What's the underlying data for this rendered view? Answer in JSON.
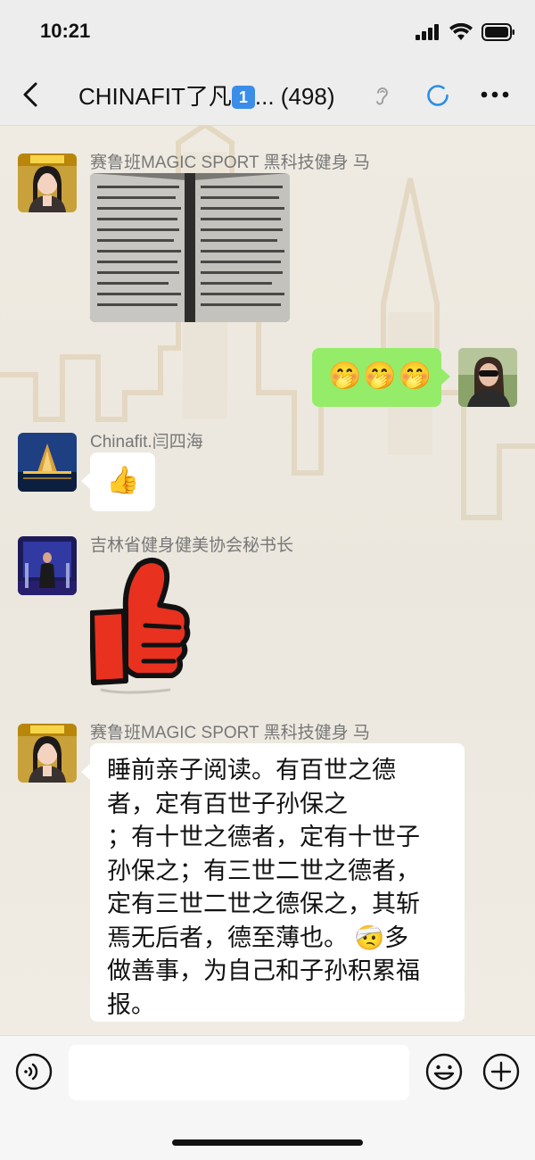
{
  "status_bar": {
    "time": "10:21"
  },
  "header": {
    "title_prefix": "CHINAFIT了凡",
    "title_keycap": "1",
    "title_suffix": "...",
    "member_count": "(498)"
  },
  "messages": [
    {
      "sender": "赛鲁班MAGIC SPORT 黑科技健身 马",
      "type": "image",
      "content": "book-pages-photo",
      "side": "left"
    },
    {
      "sender": "",
      "type": "emoji",
      "content": "🤭🤭🤭",
      "side": "right"
    },
    {
      "sender": "Chinafit.闫四海",
      "type": "emoji",
      "content": "👍",
      "side": "left"
    },
    {
      "sender": "吉林省健身健美协会秘书长",
      "type": "sticker",
      "content": "thumbs-up-sticker",
      "side": "left"
    },
    {
      "sender": "赛鲁班MAGIC SPORT 黑科技健身 马",
      "type": "text",
      "side": "left",
      "lines": [
        "睡前亲子阅读。有百世之德",
        "者，定有百世子孙保之",
        "；有十世之德者，定有十世子",
        "孙保之；有三世二世之德者，",
        "定有三世二世之德保之，其斩",
        "焉无后者，德至薄也。 🤕多",
        "做善事，为自己和子孙积累福",
        "报。"
      ]
    }
  ],
  "input_bar": {
    "voice_icon": "voice-icon",
    "emoji_icon": "emoji-icon",
    "plus_icon": "plus-icon"
  },
  "colors": {
    "self_bubble": "#95ec69",
    "refresh_blue": "#2a8de8",
    "sticker_red": "#e8311f"
  }
}
